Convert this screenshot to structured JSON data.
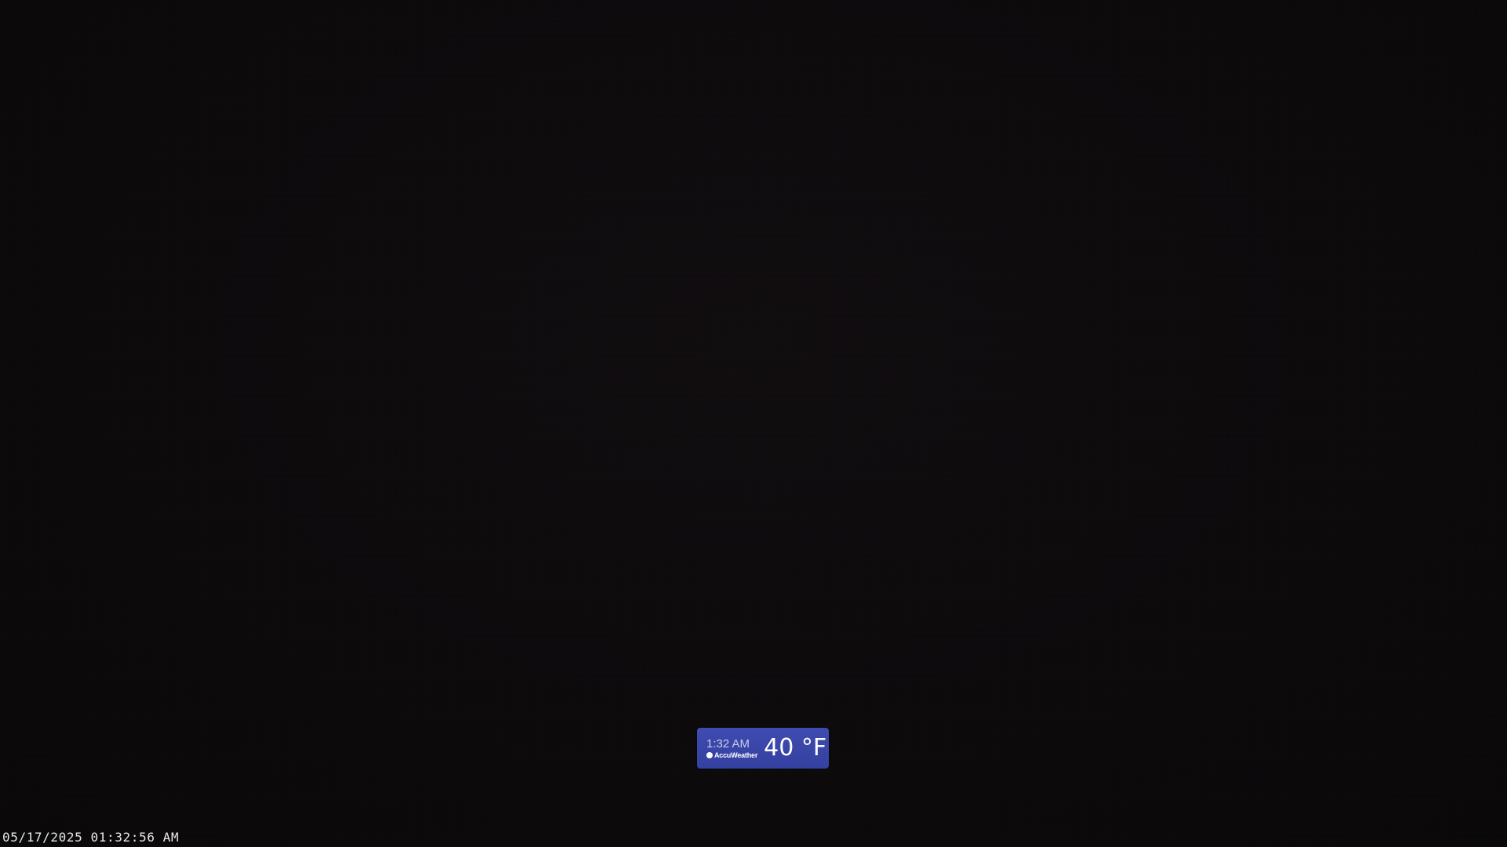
{
  "weather_badge": {
    "time": "1:32 AM",
    "brand": "AccuWeather",
    "brand_icon": "accuweather-logo-icon",
    "temperature": "40 °F",
    "background_color": "#3a46a8"
  },
  "camera": {
    "timestamp": "05/17/2025 01:32:56 AM"
  }
}
